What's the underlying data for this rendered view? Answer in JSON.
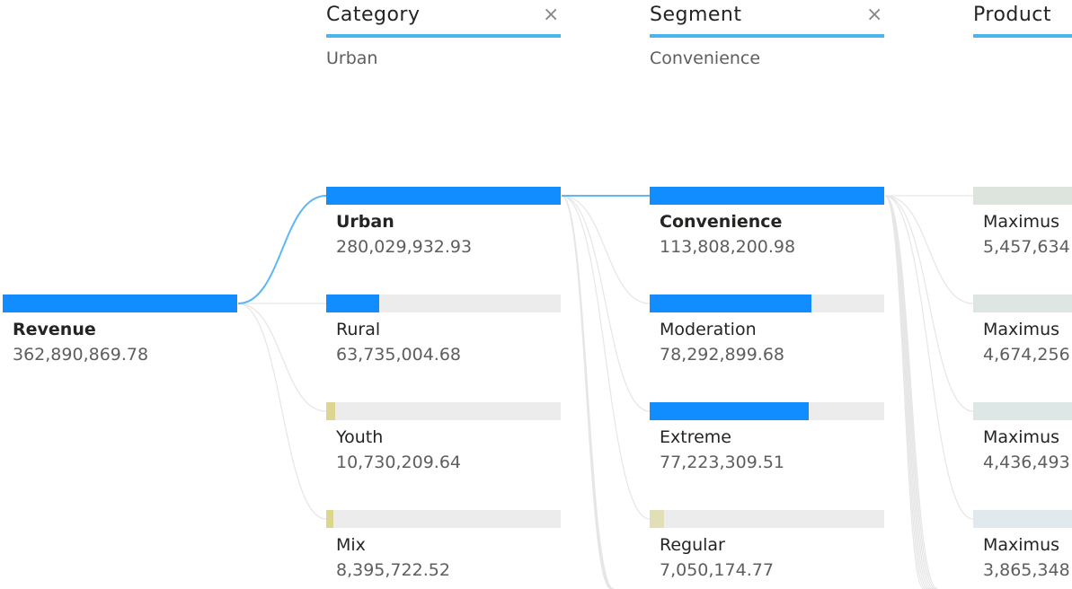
{
  "chart_data": {
    "type": "decomposition-tree",
    "root": {
      "label": "Revenue",
      "value": 362890869.78,
      "value_text": "362,890,869.78"
    },
    "levels": [
      {
        "title": "Category",
        "filter": "Urban",
        "selected": "Urban",
        "nodes": [
          {
            "label": "Urban",
            "value": 280029932.93,
            "value_text": "280,029,932.93"
          },
          {
            "label": "Rural",
            "value": 63735004.68,
            "value_text": "63,735,004.68"
          },
          {
            "label": "Youth",
            "value": 10730209.64,
            "value_text": "10,730,209.64"
          },
          {
            "label": "Mix",
            "value": 8395722.52,
            "value_text": "8,395,722.52"
          }
        ]
      },
      {
        "title": "Segment",
        "filter": "Convenience",
        "selected": "Convenience",
        "nodes": [
          {
            "label": "Convenience",
            "value": 113808200.98,
            "value_text": "113,808,200.98"
          },
          {
            "label": "Moderation",
            "value": 78292899.68,
            "value_text": "78,292,899.68"
          },
          {
            "label": "Extreme",
            "value": 77223309.51,
            "value_text": "77,223,309.51"
          },
          {
            "label": "Regular",
            "value": 7050174.77,
            "value_text": "7,050,174.77"
          }
        ]
      },
      {
        "title": "Product",
        "filter": "",
        "selected": "",
        "nodes": [
          {
            "label": "Maximus",
            "value_text": "5,457,634"
          },
          {
            "label": "Maximus",
            "value_text": "4,674,256"
          },
          {
            "label": "Maximus",
            "value_text": "4,436,493"
          },
          {
            "label": "Maximus",
            "value_text": "3,865,348"
          }
        ]
      }
    ]
  },
  "ui": {
    "close_glyph": "×",
    "colors": {
      "selected_bar": "#118dff",
      "large_bar": "#118dff",
      "small_bar": "#dcd690",
      "tiny_bar": "#e0dfb8",
      "track": "#ececec",
      "header_underline": "#4bb3ee",
      "active_link": "#5fb8f2",
      "inactive_link": "#e6e6e6",
      "product_bars": [
        "#dde3dd",
        "#dde6e2",
        "#dde7e6",
        "#dfe9ee"
      ]
    }
  }
}
